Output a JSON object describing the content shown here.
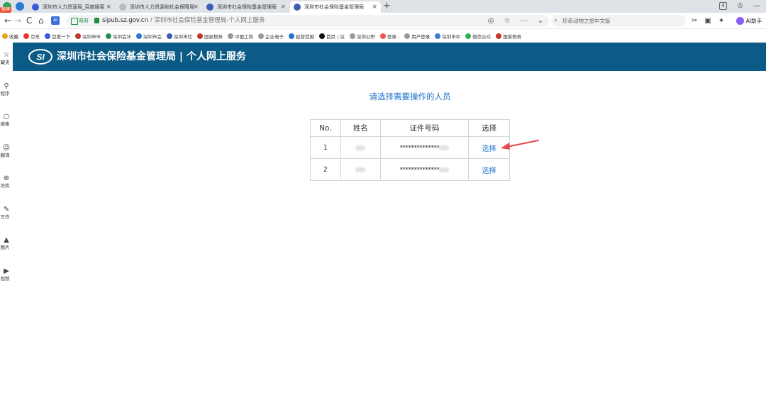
{
  "browser": {
    "beta_tag": "稳牌",
    "tabs": [
      {
        "title": "深圳市人力资源局_百度搜索",
        "active": false
      },
      {
        "title": "深圳市人力资源和社会保障局",
        "active": false
      },
      {
        "title": "深圳市社会保险基金管理局",
        "active": false
      },
      {
        "title": "深圳市社会保险基金管理局",
        "active": true
      }
    ],
    "new_tab": "+",
    "tab_close": "×",
    "window_counter": "4",
    "address": {
      "gov_badge": "政府",
      "domain": "sipub.sz.gov.cn",
      "path": " / 深圳市社会保险基金管理局-个人网上服务"
    },
    "search_placeholder": "珍奇动物之旅中文版",
    "ai_helper": "AI助手",
    "ai_square": "AI",
    "nav": {
      "back": "←",
      "forward": "→",
      "reload": "C",
      "home": "⌂"
    },
    "omni_icons": [
      "◎",
      "☆",
      "⋯",
      "⌄"
    ],
    "tool_icons": [
      "✂",
      "▣",
      "✦"
    ],
    "bookmarks": [
      {
        "label": "收藏",
        "color": "#f0a020"
      },
      {
        "label": "京东",
        "color": "#e33"
      },
      {
        "label": "百度一下",
        "color": "#3a5bd9"
      },
      {
        "label": "深圳市市",
        "color": "#c0392b"
      },
      {
        "label": "深圳会计",
        "color": "#2a8f5a"
      },
      {
        "label": "深圳市会",
        "color": "#2b7bd0"
      },
      {
        "label": "深圳市社",
        "color": "#3b5fb0"
      },
      {
        "label": "国家税务",
        "color": "#c0392b"
      },
      {
        "label": "中国工商",
        "color": "#999"
      },
      {
        "label": "企业电子",
        "color": "#999"
      },
      {
        "label": "经营范围",
        "color": "#2a6fd1"
      },
      {
        "label": "首页 | 深",
        "color": "#111"
      },
      {
        "label": "深圳公积",
        "color": "#999"
      },
      {
        "label": "登录 -",
        "color": "#e55"
      },
      {
        "label": "用户登录",
        "color": "#999"
      },
      {
        "label": "深圳市中",
        "color": "#3b7bd0"
      },
      {
        "label": "微信公众",
        "color": "#2bb24c"
      },
      {
        "label": "国家税务",
        "color": "#c0392b"
      }
    ]
  },
  "siderail": [
    {
      "icon": "☆",
      "label": "藏夹"
    },
    {
      "icon": "⚲",
      "label": "程序"
    },
    {
      "icon": "○",
      "label": "搜索"
    },
    {
      "icon": "☺",
      "label": "翻译"
    },
    {
      "icon": "⊕",
      "label": "识库"
    },
    {
      "icon": "✎",
      "label": "写作"
    },
    {
      "icon": "▲",
      "label": "图片"
    },
    {
      "icon": "▶",
      "label": "视频"
    }
  ],
  "header": {
    "logo_text": "SI",
    "title": "深圳市社会保险基金管理局 | 个人网上服务"
  },
  "main": {
    "prompt": "请选择需要操作的人员",
    "table": {
      "headers": [
        "No.",
        "姓名",
        "证件号码",
        "选择"
      ],
      "rows": [
        {
          "no": "1",
          "id": "**************",
          "select": "选择"
        },
        {
          "no": "2",
          "id": "**************",
          "select": "选择"
        }
      ]
    }
  }
}
